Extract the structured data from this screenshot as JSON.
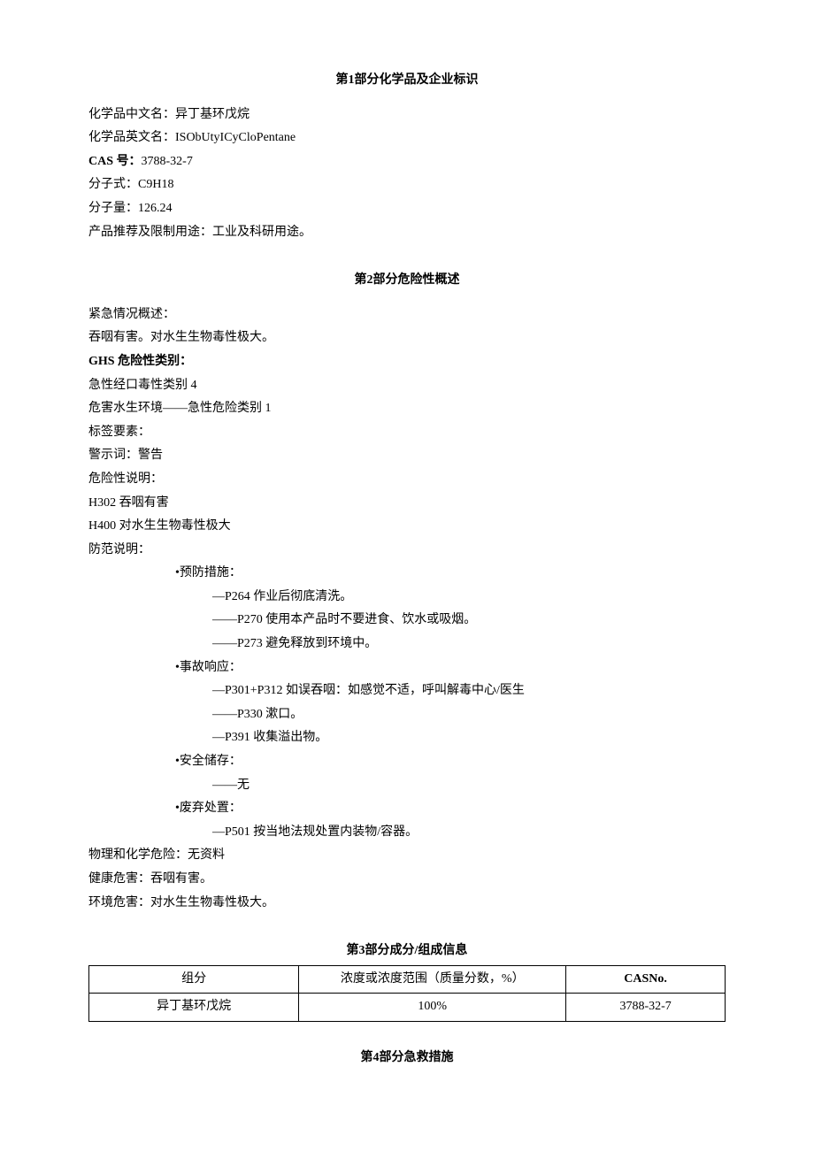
{
  "section1": {
    "heading_prefix": "第",
    "heading_num": "1",
    "heading_suffix": "部分化学品及企业标识",
    "name_cn_label": "化学品中文名：",
    "name_cn_value": "异丁基环戊烷",
    "name_en_label": "化学品英文名：",
    "name_en_value": "ISObUtyICyCloPentane",
    "cas_label": "CAS 号：",
    "cas_value": "3788-32-7",
    "formula_label": "分子式：",
    "formula_value": "C9H18",
    "mw_label": "分子量：",
    "mw_value": "126.24",
    "use_label": "产品推荐及限制用途：",
    "use_value": "工业及科研用途。"
  },
  "section2": {
    "heading_prefix": "第",
    "heading_num": "2",
    "heading_suffix": "部分危险性概述",
    "emergency_label": "紧急情况概述：",
    "emergency_text": "吞咽有害。对水生生物毒性极大。",
    "ghs_label": "GHS 危险性类别：",
    "ghs_line1": "急性经口毒性类别 4",
    "ghs_line2": "危害水生环境——急性危险类别 1",
    "label_elements": "标签要素：",
    "signal_label": "警示词：",
    "signal_value": "警告",
    "hazard_label": "危险性说明：",
    "h302": "H302 吞咽有害",
    "h400": "H400 对水生生物毒性极大",
    "precaution_label": "防范说明：",
    "prevention_header": "•预防措施：",
    "p264": "—P264 作业后彻底清洗。",
    "p270": "——P270 使用本产品时不要进食、饮水或吸烟。",
    "p273": "——P273 避免释放到环境中。",
    "response_header": "•事故响应：",
    "p301": "—P301+P312 如误吞咽：如感觉不适，呼叫解毒中心/医生",
    "p330": "——P330 漱口。",
    "p391": "—P391 收集溢出物。",
    "storage_header": "•安全储存：",
    "storage_none": "——无",
    "disposal_header": "•废弃处置：",
    "p501": "—P501 按当地法规处置内装物/容器。",
    "physchem_label": "物理和化学危险：",
    "physchem_value": "无资料",
    "health_label": "健康危害：",
    "health_value": "吞咽有害。",
    "env_label": "环境危害：",
    "env_value": "对水生生物毒性极大。"
  },
  "section3": {
    "heading_prefix": "第",
    "heading_num": "3",
    "heading_suffix": "部分成分/组成信息",
    "col1": "组分",
    "col2": "浓度或浓度范围（质量分数，%）",
    "col3": "CASNo.",
    "row1_c1": "异丁基环戊烷",
    "row1_c2": "100%",
    "row1_c3": "3788-32-7"
  },
  "section4": {
    "heading_prefix": "第",
    "heading_num": "4",
    "heading_suffix": "部分急救措施"
  }
}
